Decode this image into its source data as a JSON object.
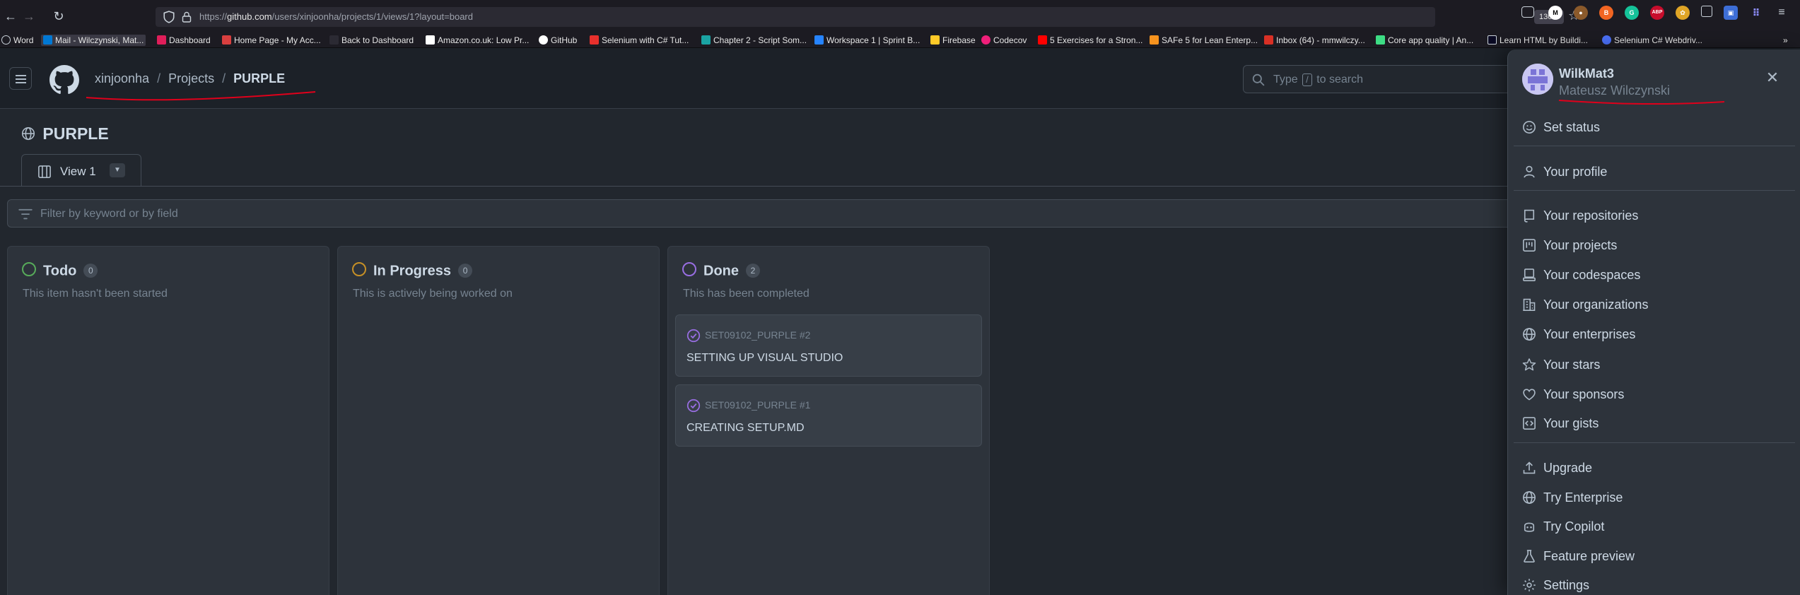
{
  "browser": {
    "url_prefix": "https://",
    "url_host": "github.com",
    "url_path": "/users/xinjoonha/projects/1/views/1?layout=board",
    "zoom": "130%",
    "bookmarks": [
      {
        "label": "Word",
        "color": "#2b579a"
      },
      {
        "label": "Mail - Wilczynski, Mat...",
        "color": "#0078d4",
        "active": true
      },
      {
        "label": "Dashboard",
        "color": "#e01e5a"
      },
      {
        "label": "Home Page - My Acc...",
        "color": "#d93f3f"
      },
      {
        "label": "Back to Dashboard",
        "color": "#1c1b22"
      },
      {
        "label": "Amazon.co.uk: Low Pr...",
        "color": "#ffffff"
      },
      {
        "label": "GitHub",
        "color": "#ffffff"
      },
      {
        "label": "Selenium with C# Tut...",
        "color": "#e8302c"
      },
      {
        "label": "Chapter 2 - Script Som...",
        "color": "#1aa3a3"
      },
      {
        "label": "Workspace 1 | Sprint B...",
        "color": "#2684ff"
      },
      {
        "label": "Firebase",
        "color": "#ffca28"
      },
      {
        "label": "Codecov",
        "color": "#f01f7a"
      },
      {
        "label": "5 Exercises for a Stron...",
        "color": "#ff0000"
      },
      {
        "label": "SAFe 5 for Lean Enterp...",
        "color": "#f7931e"
      },
      {
        "label": "Inbox (64) - mmwilczy...",
        "color": "#d93025"
      },
      {
        "label": "Core app quality | An...",
        "color": "#3ddc84"
      },
      {
        "label": "Learn HTML by Buildi...",
        "color": "#0a0a23"
      },
      {
        "label": "Selenium C# Webdriv...",
        "color": "#4a6ff5"
      }
    ]
  },
  "header": {
    "breadcrumb": [
      "xinjoonha",
      "Projects",
      "PURPLE"
    ],
    "search_prefix": "Type",
    "search_key": "/",
    "search_suffix": "to search"
  },
  "project": {
    "title": "PURPLE",
    "view_tab": "View 1",
    "filter_placeholder": "Filter by keyword or by field"
  },
  "columns": [
    {
      "title": "Todo",
      "count": "0",
      "description": "This item hasn't been started",
      "color": "#57ab5a",
      "cards": []
    },
    {
      "title": "In Progress",
      "count": "0",
      "description": "This is actively being worked on",
      "color": "#c69026",
      "cards": []
    },
    {
      "title": "Done",
      "count": "2",
      "description": "This has been completed",
      "color": "#986ee2",
      "cards": [
        {
          "ref": "SET09102_PURPLE #2",
          "title": "SETTING UP VISUAL STUDIO"
        },
        {
          "ref": "SET09102_PURPLE #1",
          "title": "CREATING SETUP.MD"
        }
      ]
    }
  ],
  "user_menu": {
    "username": "WilkMat3",
    "fullname": "Mateusz Wilczynski",
    "items": [
      {
        "label": "Set status",
        "icon": "smiley-icon"
      },
      {
        "label": "Your profile",
        "icon": "person-icon"
      },
      {
        "label": "Your repositories",
        "icon": "repo-icon"
      },
      {
        "label": "Your projects",
        "icon": "project-icon"
      },
      {
        "label": "Your codespaces",
        "icon": "codespaces-icon"
      },
      {
        "label": "Your organizations",
        "icon": "organization-icon"
      },
      {
        "label": "Your enterprises",
        "icon": "globe-icon"
      },
      {
        "label": "Your stars",
        "icon": "star-icon"
      },
      {
        "label": "Your sponsors",
        "icon": "heart-icon"
      },
      {
        "label": "Your gists",
        "icon": "code-square-icon"
      },
      {
        "label": "Upgrade",
        "icon": "upload-icon"
      },
      {
        "label": "Try Enterprise",
        "icon": "globe-icon"
      },
      {
        "label": "Try Copilot",
        "icon": "copilot-icon"
      },
      {
        "label": "Feature preview",
        "icon": "beaker-icon"
      },
      {
        "label": "Settings",
        "icon": "gear-icon"
      }
    ]
  },
  "colors": {
    "accent_done": "#986ee2",
    "annotation_red": "#e0001b"
  }
}
